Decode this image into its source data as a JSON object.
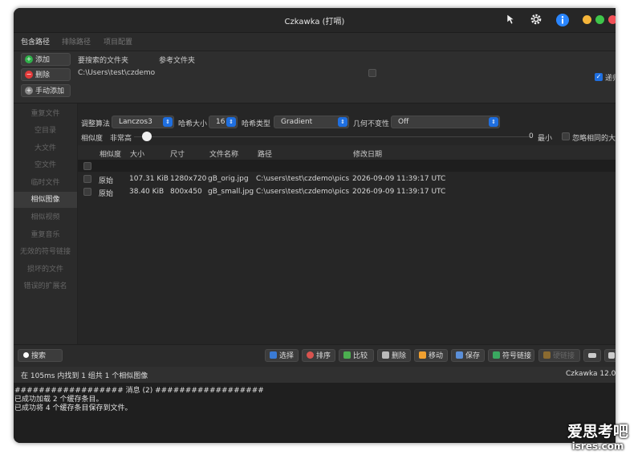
{
  "window": {
    "title": "Czkawka (打嗝)",
    "colors": {
      "close": "#f25056",
      "minimize": "#f5b53a",
      "maximize": "#3fc64a",
      "accent": "#1f6fe0"
    }
  },
  "titlebar_icons": [
    "cursor-icon",
    "gear-icon",
    "info-icon"
  ],
  "path_tabs": [
    {
      "label": "包含路径",
      "active": true
    },
    {
      "label": "排除路径",
      "active": false
    },
    {
      "label": "项目配置",
      "active": false
    }
  ],
  "path_pane": {
    "add_label": "添加",
    "remove_label": "删除",
    "manual_add_label": "手动添加",
    "col_folders": "要搜索的文件夹",
    "col_reference": "参考文件夹",
    "path_value": "C:\\Users\\test\\czdemo",
    "recursive_label": "递归"
  },
  "sidebar": {
    "items": [
      {
        "label": "重复文件",
        "active": false
      },
      {
        "label": "空目录",
        "active": false
      },
      {
        "label": "大文件",
        "active": false
      },
      {
        "label": "空文件",
        "active": false
      },
      {
        "label": "临时文件",
        "active": false
      },
      {
        "label": "相似图像",
        "active": true
      },
      {
        "label": "相似视频",
        "active": false
      },
      {
        "label": "重复音乐",
        "active": false
      },
      {
        "label": "无效的符号链接",
        "active": false
      },
      {
        "label": "损坏的文件",
        "active": false
      },
      {
        "label": "错误的扩展名",
        "active": false
      }
    ]
  },
  "options": {
    "resize_label": "调整算法",
    "resize_value": "Lanczos3",
    "hash_size_label": "哈希大小",
    "hash_size_value": "16",
    "hash_type_label": "哈希类型",
    "hash_type_value": "Gradient",
    "geometric_label": "几何不变性",
    "geometric_value": "Off",
    "similarity_label": "相似度",
    "similarity_level": "非常高",
    "slider_value": "0",
    "min_label": "最小",
    "ignore_same_label": "忽略相同的大小"
  },
  "table": {
    "headers": [
      "相似度",
      "大小",
      "尺寸",
      "文件名称",
      "路径",
      "修改日期"
    ],
    "rows": [
      {
        "similarity": "原始",
        "size": "107.31 KiB",
        "dims": "1280x720",
        "name": "gB_orig.jpg",
        "path": "C:\\users\\test\\czdemo\\pics",
        "date": "2026-09-09 11:39:17 UTC"
      },
      {
        "similarity": "原始",
        "size": "38.40 KiB",
        "dims": "800x450",
        "name": "gB_small.jpg",
        "path": "C:\\users\\test\\czdemo\\pics",
        "date": "2026-09-09 11:39:17 UTC"
      }
    ]
  },
  "bottom": {
    "search_label": "搜索",
    "select_label": "选择",
    "sort_label": "排序",
    "compare_label": "比较",
    "delete_label": "删除",
    "move_label": "移动",
    "save_label": "保存",
    "symlink_label": "符号链接",
    "hardlink_label": "硬链接"
  },
  "status": {
    "text": "在 105ms 内找到 1 组共 1 个相似图像",
    "version": "Czkawka 12.0"
  },
  "log": {
    "header": "################## 消息 (2) ##################",
    "lines": [
      "已成功加载 2 个缓存条目。",
      "已成功将 4 个缓存条目保存到文件。"
    ]
  },
  "watermark": {
    "line1": "爱思考吧",
    "line2": "isres.com"
  }
}
